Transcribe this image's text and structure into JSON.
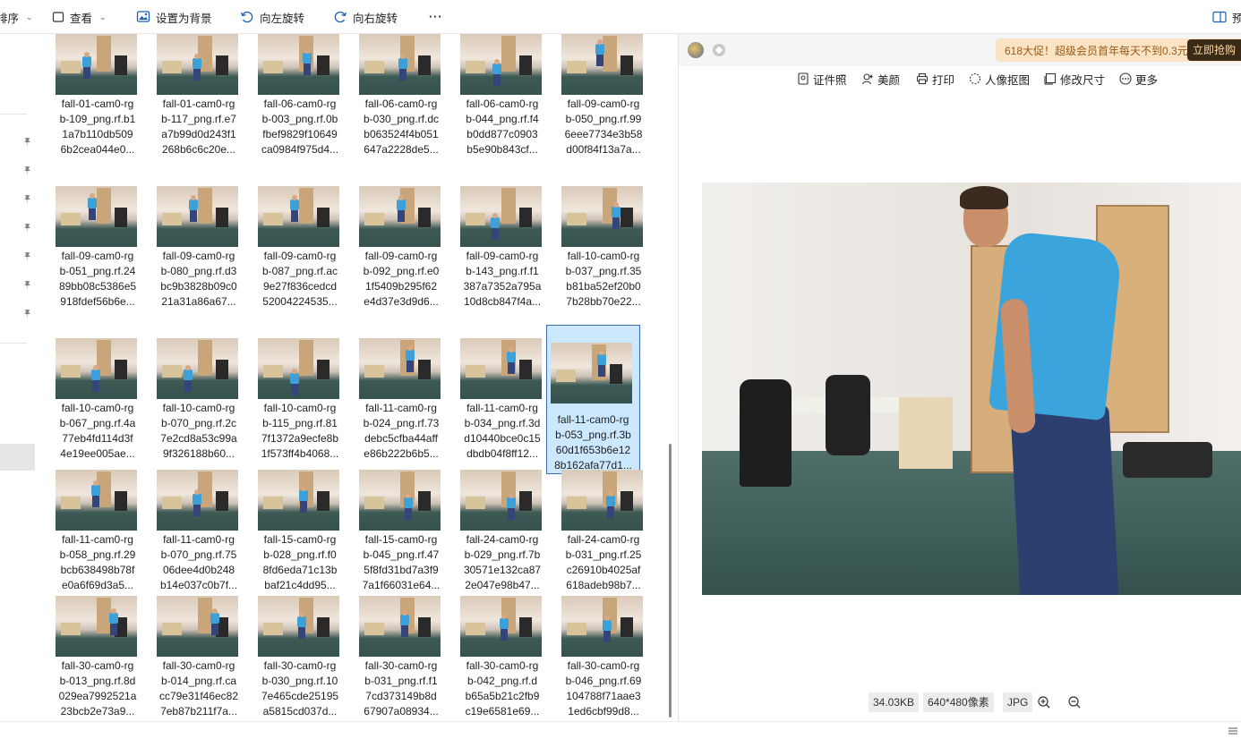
{
  "toolbar": {
    "sort_label": "排序",
    "view_label": "查看",
    "set_background_label": "设置为背景",
    "rotate_left_label": "向左旋转",
    "rotate_right_label": "向右旋转",
    "more_label": "···",
    "right_partial_label": "预"
  },
  "files": [
    [
      "fall-01-cam0-rg",
      "b-109_png.rf.b1",
      "1a7b110db509",
      "6b2cea044e0..."
    ],
    [
      "fall-01-cam0-rg",
      "b-117_png.rf.e7",
      "a7b99d0d243f1",
      "268b6c6c20e..."
    ],
    [
      "fall-06-cam0-rg",
      "b-003_png.rf.0b",
      "fbef9829f10649",
      "ca0984f975d4..."
    ],
    [
      "fall-06-cam0-rg",
      "b-030_png.rf.dc",
      "b063524f4b051",
      "647a2228de5..."
    ],
    [
      "fall-06-cam0-rg",
      "b-044_png.rf.f4",
      "b0dd877c0903",
      "b5e90b843cf..."
    ],
    [
      "fall-09-cam0-rg",
      "b-050_png.rf.99",
      "6eee7734e3b58",
      "d00f84f13a7a..."
    ],
    [
      "fall-09-cam0-rg",
      "b-051_png.rf.24",
      "89bb08c5386e5",
      "918fdef56b6e..."
    ],
    [
      "fall-09-cam0-rg",
      "b-080_png.rf.d3",
      "bc9b3828b09c0",
      "21a31a86a67..."
    ],
    [
      "fall-09-cam0-rg",
      "b-087_png.rf.ac",
      "9e27f836cedcd",
      "52004224535..."
    ],
    [
      "fall-09-cam0-rg",
      "b-092_png.rf.e0",
      "1f5409b295f62",
      "e4d37e3d9d6..."
    ],
    [
      "fall-09-cam0-rg",
      "b-143_png.rf.f1",
      "387a7352a795a",
      "10d8cb847f4a..."
    ],
    [
      "fall-10-cam0-rg",
      "b-037_png.rf.35",
      "b81ba52ef20b0",
      "7b28bb70e22..."
    ],
    [
      "fall-10-cam0-rg",
      "b-067_png.rf.4a",
      "77eb4fd114d3f",
      "4e19ee005ae..."
    ],
    [
      "fall-10-cam0-rg",
      "b-070_png.rf.2c",
      "7e2cd8a53c99a",
      "9f326188b60..."
    ],
    [
      "fall-10-cam0-rg",
      "b-115_png.rf.81",
      "7f1372a9ecfe8b",
      "1f573ff4b4068..."
    ],
    [
      "fall-11-cam0-rg",
      "b-024_png.rf.73",
      "debc5cfba44aff",
      "e86b222b6b5..."
    ],
    [
      "fall-11-cam0-rg",
      "b-034_png.rf.3d",
      "d10440bce0c15",
      "dbdb04f8ff12..."
    ],
    [
      "fall-11-cam0-rg",
      "b-053_png.rf.3b",
      "60d1f653b6e12",
      "8b162afa77d1..."
    ],
    [
      "fall-11-cam0-rg",
      "b-058_png.rf.29",
      "bcb638498b78f",
      "e0a6f69d3a5..."
    ],
    [
      "fall-11-cam0-rg",
      "b-070_png.rf.75",
      "06dee4d0b248",
      "b14e037c0b7f..."
    ],
    [
      "fall-15-cam0-rg",
      "b-028_png.rf.f0",
      "8fd6eda71c13b",
      "baf21c4dd95..."
    ],
    [
      "fall-15-cam0-rg",
      "b-045_png.rf.47",
      "5f8fd31bd7a3f9",
      "7a1f66031e64..."
    ],
    [
      "fall-24-cam0-rg",
      "b-029_png.rf.7b",
      "30571e132ca87",
      "2e047e98b47..."
    ],
    [
      "fall-24-cam0-rg",
      "b-031_png.rf.25",
      "c26910b4025af",
      "618adeb98b7..."
    ],
    [
      "fall-30-cam0-rg",
      "b-013_png.rf.8d",
      "029ea7992521a",
      "23bcb2e73a9..."
    ],
    [
      "fall-30-cam0-rg",
      "b-014_png.rf.ca",
      "cc79e31f46ec82",
      "7eb87b211f7a..."
    ],
    [
      "fall-30-cam0-rg",
      "b-030_png.rf.10",
      "7e465cde25195",
      "a5815cd037d..."
    ],
    [
      "fall-30-cam0-rg",
      "b-031_png.rf.f1",
      "7cd373149b8d",
      "67907a08934..."
    ],
    [
      "fall-30-cam0-rg",
      "b-042_png.rf.d",
      "b65a5b21c2fb9",
      "c19e6581e69..."
    ],
    [
      "fall-30-cam0-rg",
      "b-046_png.rf.69",
      "104788f71aae3",
      "1ed6cbf99d8..."
    ]
  ],
  "selected_index": 17,
  "preview": {
    "promo_text": "618大促！超级会员首年每天不到0.3元",
    "promo_button": "立即抢购",
    "actions": {
      "id_photo": "证件照",
      "beautify": "美颜",
      "print": "打印",
      "cutout": "人像抠图",
      "resize": "修改尺寸",
      "more": "更多"
    },
    "file_size": "34.03KB",
    "dimensions": "640*480像素",
    "format": "JPG"
  },
  "colors": {
    "selection_bg": "#cce8ff",
    "selection_border": "#3d6eb5",
    "promo_bg": "#fbe4c4"
  }
}
